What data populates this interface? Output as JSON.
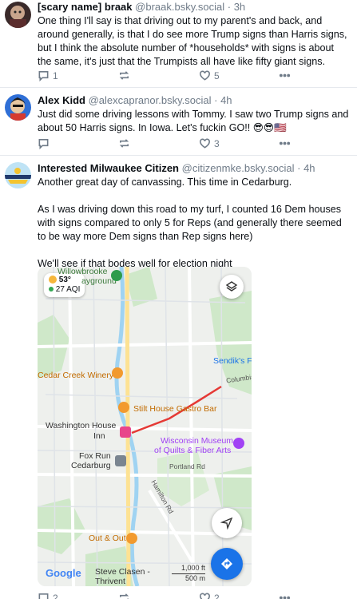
{
  "posts": [
    {
      "author": "[scary name] braak",
      "handle": "@braak.bsky.social",
      "time": "3h",
      "text": "One thing I'll say is that driving out to my parent's and back, and around generally, is that I do see more Trump signs than Harris signs, but I think the absolute number of *households* with signs is about the same, it's just that the Trumpists all have like fifty giant signs.",
      "replies": "1",
      "reposts": "",
      "likes": "5"
    },
    {
      "author": "Alex Kidd",
      "handle": "@alexcapranor.bsky.social",
      "time": "4h",
      "text": "Just did some driving lessons with Tommy.  I saw two Trump signs and about 50 Harris signs. In Iowa.  Let's fuckin GO!! 😎😎🇺🇸",
      "replies": "",
      "reposts": "",
      "likes": "3"
    },
    {
      "author": "Interested Milwaukee Citizen",
      "handle": "@citizenmke.bsky.social",
      "time": "4h",
      "paragraphs": [
        "Another great day of canvassing. This time in Cedarburg.",
        "As I was driving down this road to my turf, I counted 16 Dem houses with signs compared to only 5 for Reps (and generally there seemed to be way more Dem signs than Rep signs here)",
        "We'll see if that bodes well for election night"
      ],
      "replies": "2",
      "reposts": "",
      "likes": "2"
    }
  ],
  "map": {
    "weather_temp": "53°",
    "weather_aqi": "27 AQI",
    "labels": {
      "willowbrooke": "Willowbrooke",
      "playground": "ayground",
      "sendik": "Sendik's Fo",
      "cedar_creek": "Cedar Creek Winery",
      "columbia": "Columbia",
      "stilt_house": "Stilt House Gastro Bar",
      "washington_house_1": "Washington House",
      "washington_house_2": "Inn",
      "museum_1": "Wisconsin Museum",
      "museum_2": "of Quilts & Fiber Arts",
      "fox_run_1": "Fox Run",
      "fox_run_2": "Cedarburg",
      "portland": "Portland Rd",
      "hamilton": "Hamilton Rd",
      "out_out": "Out & Out",
      "google": "Google",
      "steve_1": "Steve Clasen -",
      "steve_2": "Thrivent",
      "scale_ft": "1,000 ft",
      "scale_m": "500 m"
    }
  },
  "colors": {
    "accent_blue": "#1a73e8",
    "route_red": "#e53935",
    "orange_pin": "#f29a2e"
  }
}
